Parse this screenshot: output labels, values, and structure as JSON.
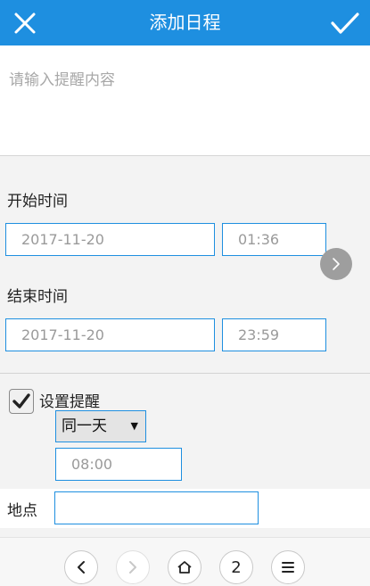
{
  "header": {
    "title": "添加日程",
    "close_icon": "close-icon",
    "confirm_icon": "check-icon",
    "accent_color": "#1e8fe0"
  },
  "content": {
    "placeholder": "请输入提醒内容",
    "value": ""
  },
  "start": {
    "label": "开始时间",
    "date": "2017-11-20",
    "time": "01:36"
  },
  "end": {
    "label": "结束时间",
    "date": "2017-11-20",
    "time": "23:59"
  },
  "reminder": {
    "label": "设置提醒",
    "checked": true,
    "day_option": "同一天",
    "time": "08:00"
  },
  "location": {
    "label": "地点",
    "value": ""
  },
  "bottom_nav": {
    "page_number": "2",
    "icons": [
      "chevron-left-icon",
      "chevron-right-icon",
      "home-icon",
      "menu-icon"
    ]
  }
}
